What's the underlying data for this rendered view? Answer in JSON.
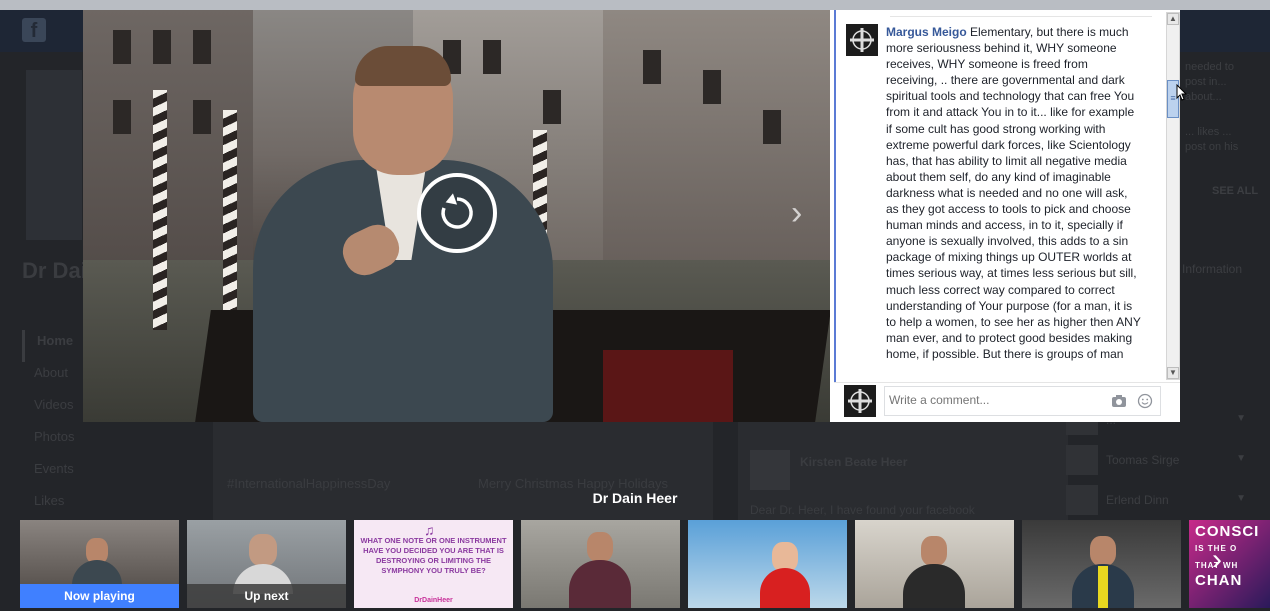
{
  "background": {
    "page_name": "Dr Dain Heer",
    "nav_items": [
      "Home",
      "About",
      "Videos",
      "Photos",
      "Events",
      "Likes"
    ],
    "post_left_text": "#InternationalHappinessDay",
    "post_left_text2": "Merry Christmas Happy Holidays",
    "post_right_name": "Kirsten Beate Heer",
    "post_right_text": "Dear Dr. Heer, I have found your facebook",
    "side_text_1": "needed to post in... about...",
    "side_text_2": "... likes ... post on his",
    "see_all": "SEE ALL",
    "info_label": "Information",
    "friends": [
      "...",
      "Toomas Sirge",
      "Erlend Dinn"
    ]
  },
  "video": {
    "replay_icon": "replay-icon",
    "next_icon": "chevron-right-icon"
  },
  "comment": {
    "author": "Margus Meigo",
    "text": "Elementary, but there is much more seriousness behind it, WHY someone receives, WHY someone is freed from receiving, .. there are governmental and dark spiritual tools and technology that can free You from it and attack You in to it... like for example if some cult has good strong working with extreme powerful dark forces, like Scientology has, that has ability to limit all negative media about them self, do any kind of imaginable darkness what is needed and no one will ask, as they got access to tools to pick and choose human minds and access, in to it, specially if anyone is sexually involved, this adds to a sin package of mixing things up OUTER worlds at times serious way, at times less serious but sill, much less correct way compared to correct understanding of Your purpose (for a man, it is to help a women, to see her as higher then ANY man ever, and to protect good besides making home, if possible. But there is groups of man"
  },
  "composer": {
    "placeholder": "Write a comment...",
    "camera_icon": "camera-icon",
    "smiley_icon": "smiley-icon"
  },
  "strip": {
    "title": "Dr Dain Heer",
    "now_playing": "Now playing",
    "up_next": "Up next",
    "quote_text": "WHAT ONE NOTE OR ONE INSTRUMENT HAVE YOU DECIDED YOU ARE THAT IS DESTROYING OR LIMITING THE SYMPHONY YOU TRULY BE?",
    "quote_sign": "DrDainHeer",
    "last_thumb_text": "CONSCI",
    "last_thumb_sub": "IS THE O",
    "last_thumb_sub2": "THAT WH",
    "last_thumb_sub3": "CHAN",
    "next_icon": "chevron-right-icon"
  },
  "colors": {
    "accent": "#4080ff",
    "link": "#365899"
  }
}
